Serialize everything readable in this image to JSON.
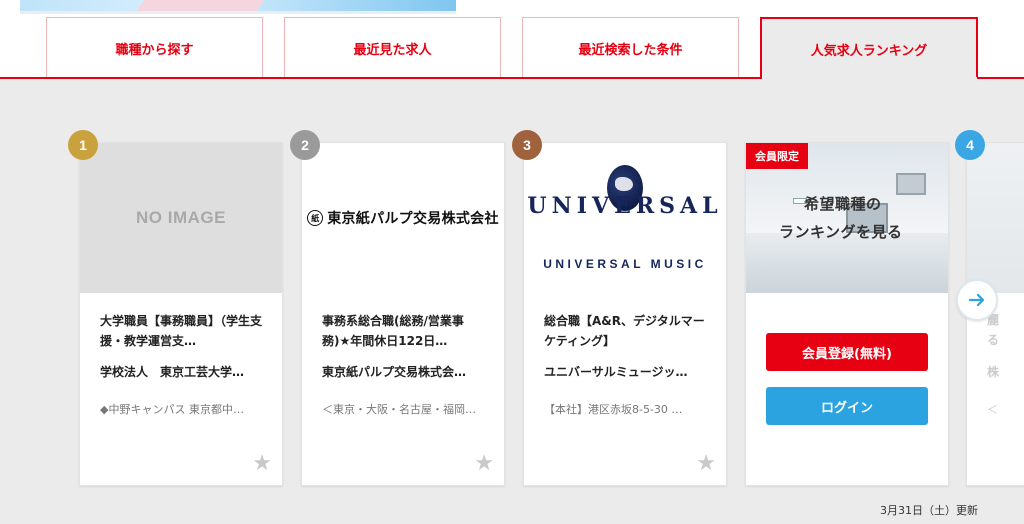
{
  "tabs": [
    {
      "label": "職種から探す"
    },
    {
      "label": "最近見た求人"
    },
    {
      "label": "最近検索した条件"
    },
    {
      "label": "人気求人ランキング"
    }
  ],
  "active_tab": "人気求人ランキング",
  "ranking": [
    {
      "rank": "1",
      "badge_color": "#c9a13d",
      "image": "NO IMAGE",
      "title": "大学職員【事務職員】（学生支援・教学運営支…",
      "company": "学校法人　東京工芸大学…",
      "location": "◆中野キャンパス 東京都中…"
    },
    {
      "rank": "2",
      "badge_color": "#9a9a9a",
      "logo_text": "東京紙パルプ交易株式会社",
      "title": "事務系総合職(総務/営業事務)★年間休日122日…",
      "company": "東京紙パルプ交易株式会…",
      "location": "＜東京・大阪・名古屋・福岡…"
    },
    {
      "rank": "3",
      "badge_color": "#a0623c",
      "logo_big": "UNIVERSAL",
      "logo_small": "UNIVERSAL MUSIC",
      "title": "総合職【A&R、デジタルマーケティング】",
      "company": "ユニバーサルミュージッ…",
      "location": "【本社】港区赤坂8-5-30 …"
    }
  ],
  "member_card": {
    "label": "会員限定",
    "cta_line1": "希望職種の",
    "cta_line2": "ランキングを見る",
    "register_button": "会員登録(無料)",
    "login_button": "ログイン"
  },
  "partial_card": {
    "rank": "4",
    "badge_color": "#3aa7e4",
    "t1": "麗",
    "t2": "る",
    "t3": "株",
    "t4": "＜"
  },
  "updated": "3月31日（土）更新",
  "colors": {
    "accent": "#e60012",
    "login": "#2aa3e0",
    "background": "#ebebeb"
  }
}
